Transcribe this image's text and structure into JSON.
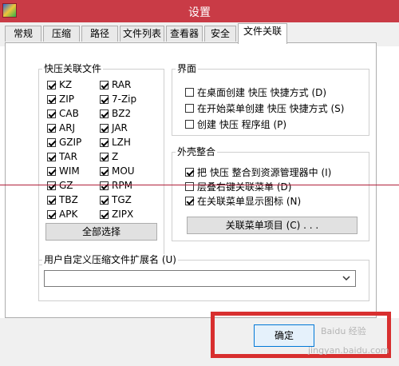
{
  "window": {
    "title": "设置"
  },
  "tabs": [
    {
      "label": "常规",
      "active": false
    },
    {
      "label": "压缩",
      "active": false
    },
    {
      "label": "路径",
      "active": false
    },
    {
      "label": "文件列表",
      "active": false
    },
    {
      "label": "查看器",
      "active": false
    },
    {
      "label": "安全",
      "active": false
    },
    {
      "label": "文件关联",
      "active": true
    }
  ],
  "assoc_group": {
    "title": "快压关联文件",
    "items_left": [
      {
        "label": "KZ",
        "checked": true
      },
      {
        "label": "ZIP",
        "checked": true
      },
      {
        "label": "CAB",
        "checked": true
      },
      {
        "label": "ARJ",
        "checked": true
      },
      {
        "label": "GZIP",
        "checked": true
      },
      {
        "label": "TAR",
        "checked": true
      },
      {
        "label": "WIM",
        "checked": true
      },
      {
        "label": "GZ",
        "checked": true
      },
      {
        "label": "TBZ",
        "checked": true
      },
      {
        "label": "APK",
        "checked": true
      }
    ],
    "items_right": [
      {
        "label": "RAR",
        "checked": true
      },
      {
        "label": "7-Zip",
        "checked": true
      },
      {
        "label": "BZ2",
        "checked": true
      },
      {
        "label": "JAR",
        "checked": true
      },
      {
        "label": "LZH",
        "checked": true
      },
      {
        "label": "Z",
        "checked": true
      },
      {
        "label": "MOU",
        "checked": true
      },
      {
        "label": "RPM",
        "checked": true
      },
      {
        "label": "TGZ",
        "checked": true
      },
      {
        "label": "ZIPX",
        "checked": true
      }
    ],
    "select_all_label": "全部选择"
  },
  "interface_group": {
    "title": "界面",
    "items": [
      {
        "label": "在桌面创建 快压 快捷方式 (D)",
        "checked": false
      },
      {
        "label": "在开始菜单创建 快压 快捷方式 (S)",
        "checked": false
      },
      {
        "label": "创建 快压 程序组 (P)",
        "checked": false
      }
    ]
  },
  "shell_group": {
    "title": "外壳整合",
    "items": [
      {
        "label": "把 快压 整合到资源管理器中 (I)",
        "checked": true
      },
      {
        "label": "层叠右键关联菜单 (D)",
        "checked": false
      },
      {
        "label": "在关联菜单显示图标 (N)",
        "checked": true
      }
    ],
    "menu_items_button": "关联菜单项目 (C) . . ."
  },
  "custom_ext": {
    "title": "用户自定义压缩文件扩展名 (U)",
    "value": ""
  },
  "footer": {
    "ok_label": "确定"
  },
  "watermark": {
    "line1": "Baidu 经验",
    "line2": "jingyan.baidu.com"
  },
  "colors": {
    "titlebar": "#c93b46",
    "highlight": "#d82f2f"
  },
  "icons": {
    "app": "app-logo-icon",
    "checkmark": "check-icon",
    "dropdown": "chevron-down-icon"
  }
}
